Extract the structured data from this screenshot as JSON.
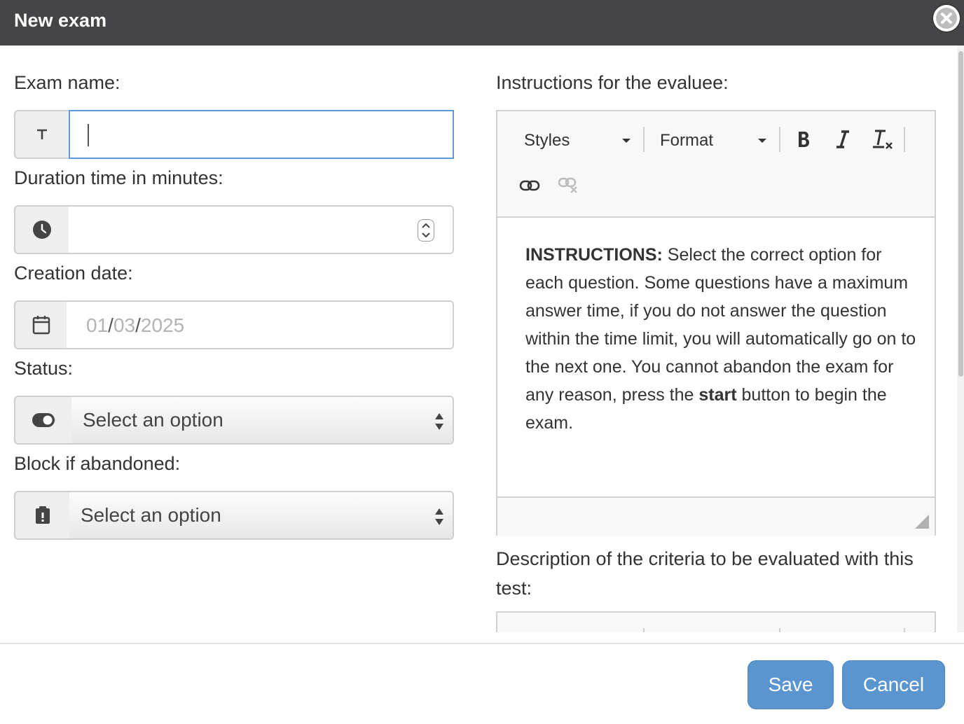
{
  "dialog": {
    "title": "New exam"
  },
  "form": {
    "exam_name": {
      "label": "Exam name:",
      "value": "",
      "icon": "text-icon"
    },
    "duration": {
      "label": "Duration time in minutes:",
      "value": "",
      "icon": "clock-icon"
    },
    "creation_date": {
      "label": "Creation date:",
      "day": "01",
      "month": "03",
      "year": "2025",
      "sep": "/",
      "icon": "calendar-icon"
    },
    "status": {
      "label": "Status:",
      "selected": "Select an option",
      "icon": "toggle-icon"
    },
    "block_if_abandoned": {
      "label": "Block if abandoned:",
      "selected": "Select an option",
      "icon": "clipboard-alert-icon"
    }
  },
  "instructions": {
    "label": "Instructions for the evaluee:",
    "toolbar": {
      "styles_label": "Styles",
      "format_label": "Format"
    },
    "content": {
      "lead_bold": "INSTRUCTIONS:",
      "text_1": " Select the correct option for each question. Some questions have a maximum answer time, if you do not answer the question within the time limit, you will automatically go on to the next one. You cannot abandon the exam for any reason, press the ",
      "bold_word": "start",
      "text_2": " button to begin the exam."
    }
  },
  "criteria": {
    "label": "Description of the criteria to be evaluated with this test:"
  },
  "footer": {
    "save_label": "Save",
    "cancel_label": "Cancel"
  },
  "colors": {
    "titlebar": "#454446",
    "button": "#5b95cf",
    "focus": "#5b9bd5"
  }
}
